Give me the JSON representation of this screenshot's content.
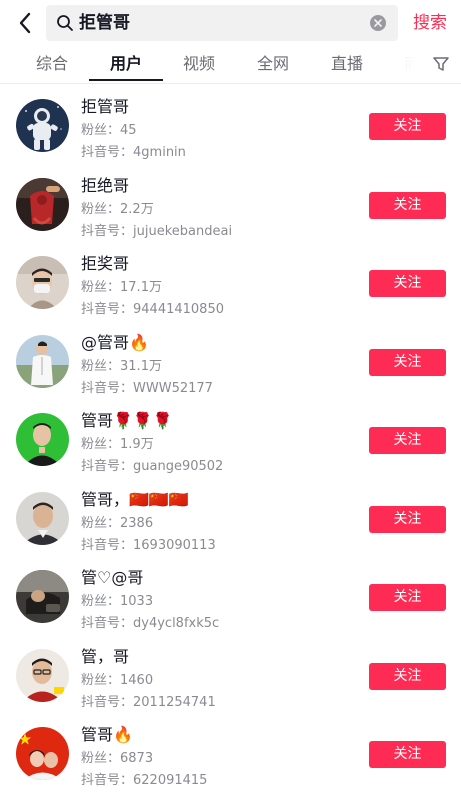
{
  "search": {
    "query": "拒管哥",
    "submit_label": "搜索"
  },
  "tabs": [
    {
      "label": "综合",
      "active": false
    },
    {
      "label": "用户",
      "active": true
    },
    {
      "label": "视频",
      "active": false
    },
    {
      "label": "全网",
      "active": false
    },
    {
      "label": "直播",
      "active": false
    },
    {
      "label": "商",
      "active": false
    }
  ],
  "users": [
    {
      "name": "拒管哥",
      "fans_label": "粉丝：",
      "fans": "45",
      "id_label": "抖音号：",
      "id": "4gminin",
      "follow_label": "关注",
      "avatar": "astronaut"
    },
    {
      "name": "拒绝哥",
      "fans_label": "粉丝：",
      "fans": "2.2万",
      "id_label": "抖音号：",
      "id": "jujuekebandeai",
      "follow_label": "关注",
      "avatar": "red-figure"
    },
    {
      "name": "拒奖哥",
      "fans_label": "粉丝：",
      "fans": "17.1万",
      "id_label": "抖音号：",
      "id": "94441410850",
      "follow_label": "关注",
      "avatar": "masked-man"
    },
    {
      "name": "@管哥🔥",
      "fans_label": "粉丝：",
      "fans": "31.1万",
      "id_label": "抖音号：",
      "id": "WWW52177",
      "follow_label": "关注",
      "avatar": "white-suit"
    },
    {
      "name": "管哥🌹🌹🌹",
      "fans_label": "粉丝：",
      "fans": "1.9万",
      "id_label": "抖音号：",
      "id": "guange90502",
      "follow_label": "关注",
      "avatar": "green-bg"
    },
    {
      "name": "管哥，🇨🇳🇨🇳🇨🇳",
      "fans_label": "粉丝：",
      "fans": "2386",
      "id_label": "抖音号：",
      "id": "1693090113",
      "follow_label": "关注",
      "avatar": "man-portrait"
    },
    {
      "name": "管♡@哥",
      "fans_label": "粉丝：",
      "fans": "1033",
      "id_label": "抖音号：",
      "id": "dy4ycl8fxk5c",
      "follow_label": "关注",
      "avatar": "dark-car"
    },
    {
      "name": "管，哥",
      "fans_label": "粉丝：",
      "fans": "1460",
      "id_label": "抖音号：",
      "id": "2011254741",
      "follow_label": "关注",
      "avatar": "glasses-man"
    },
    {
      "name": "管哥🔥",
      "fans_label": "粉丝：",
      "fans": "6873",
      "id_label": "抖音号：",
      "id": "622091415",
      "follow_label": "关注",
      "avatar": "flag-couple"
    }
  ],
  "colors": {
    "accent": "#fe2c55",
    "text_primary": "#161823",
    "text_secondary": "#8a8b91"
  }
}
